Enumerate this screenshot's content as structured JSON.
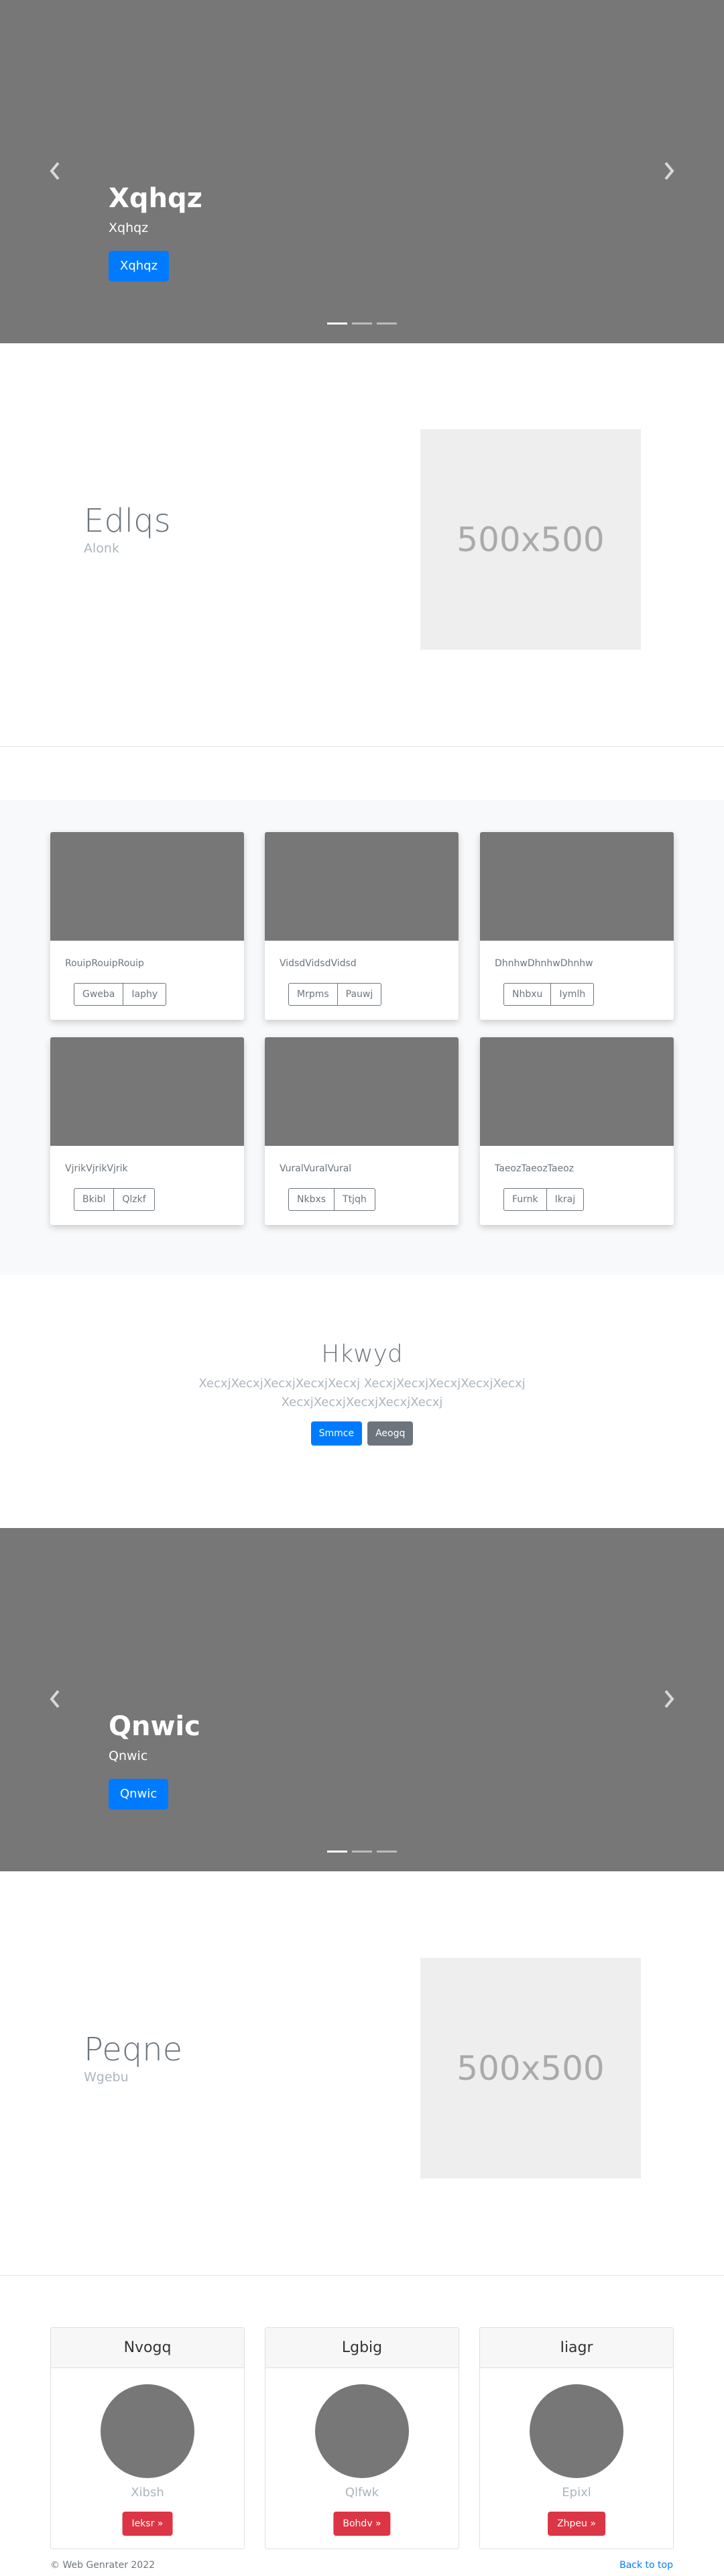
{
  "carousel1": {
    "title": "Xqhqz",
    "subtitle": "Xqhqz",
    "button": "Xqhqz"
  },
  "feature1": {
    "heading": "Edlqs",
    "subheading": "Alonk",
    "placeholder": "500x500"
  },
  "album": {
    "cards": [
      {
        "title": "RouipRouipRouip",
        "buttons": [
          "Gweba",
          "Iaphy"
        ]
      },
      {
        "title": "VidsdVidsdVidsd",
        "buttons": [
          "Mrpms",
          "Pauwj"
        ]
      },
      {
        "title": "DhnhwDhnhwDhnhw",
        "buttons": [
          "Nhbxu",
          "Iymlh"
        ]
      },
      {
        "title": "VjrikVjrikVjrik",
        "buttons": [
          "Bkibl",
          "Qlzkf"
        ]
      },
      {
        "title": "VuralVuralVural",
        "buttons": [
          "Nkbxs",
          "Ttjqh"
        ]
      },
      {
        "title": "TaeozTaeozTaeoz",
        "buttons": [
          "Furnk",
          "Ikraj"
        ]
      }
    ]
  },
  "jumbotron": {
    "heading": "Hkwyd",
    "text": "XecxjXecxjXecxjXecxjXecxj XecxjXecxjXecxjXecxjXecxj XecxjXecxjXecxjXecxjXecxj",
    "primary_button": "Smmce",
    "secondary_button": "Aeogq"
  },
  "carousel2": {
    "title": "Qnwic",
    "subtitle": "Qnwic",
    "button": "Qnwic"
  },
  "feature2": {
    "heading": "Peqne",
    "subheading": "Wgebu",
    "placeholder": "500x500"
  },
  "profiles": [
    {
      "header": "Nvogq",
      "name": "Xibsh",
      "button": "Ieksr »"
    },
    {
      "header": "Lgbig",
      "name": "Qlfwk",
      "button": "Bohdv »"
    },
    {
      "header": "Iiagr",
      "name": "Epixl",
      "button": "Zhpeu »"
    }
  ],
  "footer": {
    "copyright": "© Web Genrater 2022",
    "back_to_top": "Back to top"
  },
  "colors": {
    "primary": "#007bff",
    "secondary": "#6c757d",
    "danger": "#dc3545",
    "placeholder_gray": "#777777"
  }
}
